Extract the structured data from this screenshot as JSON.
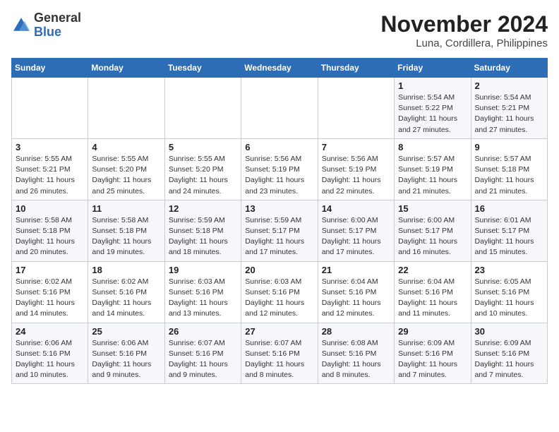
{
  "logo": {
    "general": "General",
    "blue": "Blue"
  },
  "header": {
    "month_year": "November 2024",
    "location": "Luna, Cordillera, Philippines"
  },
  "weekdays": [
    "Sunday",
    "Monday",
    "Tuesday",
    "Wednesday",
    "Thursday",
    "Friday",
    "Saturday"
  ],
  "weeks": [
    [
      {
        "day": "",
        "info": ""
      },
      {
        "day": "",
        "info": ""
      },
      {
        "day": "",
        "info": ""
      },
      {
        "day": "",
        "info": ""
      },
      {
        "day": "",
        "info": ""
      },
      {
        "day": "1",
        "info": "Sunrise: 5:54 AM\nSunset: 5:22 PM\nDaylight: 11 hours\nand 27 minutes."
      },
      {
        "day": "2",
        "info": "Sunrise: 5:54 AM\nSunset: 5:21 PM\nDaylight: 11 hours\nand 27 minutes."
      }
    ],
    [
      {
        "day": "3",
        "info": "Sunrise: 5:55 AM\nSunset: 5:21 PM\nDaylight: 11 hours\nand 26 minutes."
      },
      {
        "day": "4",
        "info": "Sunrise: 5:55 AM\nSunset: 5:20 PM\nDaylight: 11 hours\nand 25 minutes."
      },
      {
        "day": "5",
        "info": "Sunrise: 5:55 AM\nSunset: 5:20 PM\nDaylight: 11 hours\nand 24 minutes."
      },
      {
        "day": "6",
        "info": "Sunrise: 5:56 AM\nSunset: 5:19 PM\nDaylight: 11 hours\nand 23 minutes."
      },
      {
        "day": "7",
        "info": "Sunrise: 5:56 AM\nSunset: 5:19 PM\nDaylight: 11 hours\nand 22 minutes."
      },
      {
        "day": "8",
        "info": "Sunrise: 5:57 AM\nSunset: 5:19 PM\nDaylight: 11 hours\nand 21 minutes."
      },
      {
        "day": "9",
        "info": "Sunrise: 5:57 AM\nSunset: 5:18 PM\nDaylight: 11 hours\nand 21 minutes."
      }
    ],
    [
      {
        "day": "10",
        "info": "Sunrise: 5:58 AM\nSunset: 5:18 PM\nDaylight: 11 hours\nand 20 minutes."
      },
      {
        "day": "11",
        "info": "Sunrise: 5:58 AM\nSunset: 5:18 PM\nDaylight: 11 hours\nand 19 minutes."
      },
      {
        "day": "12",
        "info": "Sunrise: 5:59 AM\nSunset: 5:18 PM\nDaylight: 11 hours\nand 18 minutes."
      },
      {
        "day": "13",
        "info": "Sunrise: 5:59 AM\nSunset: 5:17 PM\nDaylight: 11 hours\nand 17 minutes."
      },
      {
        "day": "14",
        "info": "Sunrise: 6:00 AM\nSunset: 5:17 PM\nDaylight: 11 hours\nand 17 minutes."
      },
      {
        "day": "15",
        "info": "Sunrise: 6:00 AM\nSunset: 5:17 PM\nDaylight: 11 hours\nand 16 minutes."
      },
      {
        "day": "16",
        "info": "Sunrise: 6:01 AM\nSunset: 5:17 PM\nDaylight: 11 hours\nand 15 minutes."
      }
    ],
    [
      {
        "day": "17",
        "info": "Sunrise: 6:02 AM\nSunset: 5:16 PM\nDaylight: 11 hours\nand 14 minutes."
      },
      {
        "day": "18",
        "info": "Sunrise: 6:02 AM\nSunset: 5:16 PM\nDaylight: 11 hours\nand 14 minutes."
      },
      {
        "day": "19",
        "info": "Sunrise: 6:03 AM\nSunset: 5:16 PM\nDaylight: 11 hours\nand 13 minutes."
      },
      {
        "day": "20",
        "info": "Sunrise: 6:03 AM\nSunset: 5:16 PM\nDaylight: 11 hours\nand 12 minutes."
      },
      {
        "day": "21",
        "info": "Sunrise: 6:04 AM\nSunset: 5:16 PM\nDaylight: 11 hours\nand 12 minutes."
      },
      {
        "day": "22",
        "info": "Sunrise: 6:04 AM\nSunset: 5:16 PM\nDaylight: 11 hours\nand 11 minutes."
      },
      {
        "day": "23",
        "info": "Sunrise: 6:05 AM\nSunset: 5:16 PM\nDaylight: 11 hours\nand 10 minutes."
      }
    ],
    [
      {
        "day": "24",
        "info": "Sunrise: 6:06 AM\nSunset: 5:16 PM\nDaylight: 11 hours\nand 10 minutes."
      },
      {
        "day": "25",
        "info": "Sunrise: 6:06 AM\nSunset: 5:16 PM\nDaylight: 11 hours\nand 9 minutes."
      },
      {
        "day": "26",
        "info": "Sunrise: 6:07 AM\nSunset: 5:16 PM\nDaylight: 11 hours\nand 9 minutes."
      },
      {
        "day": "27",
        "info": "Sunrise: 6:07 AM\nSunset: 5:16 PM\nDaylight: 11 hours\nand 8 minutes."
      },
      {
        "day": "28",
        "info": "Sunrise: 6:08 AM\nSunset: 5:16 PM\nDaylight: 11 hours\nand 8 minutes."
      },
      {
        "day": "29",
        "info": "Sunrise: 6:09 AM\nSunset: 5:16 PM\nDaylight: 11 hours\nand 7 minutes."
      },
      {
        "day": "30",
        "info": "Sunrise: 6:09 AM\nSunset: 5:16 PM\nDaylight: 11 hours\nand 7 minutes."
      }
    ]
  ]
}
